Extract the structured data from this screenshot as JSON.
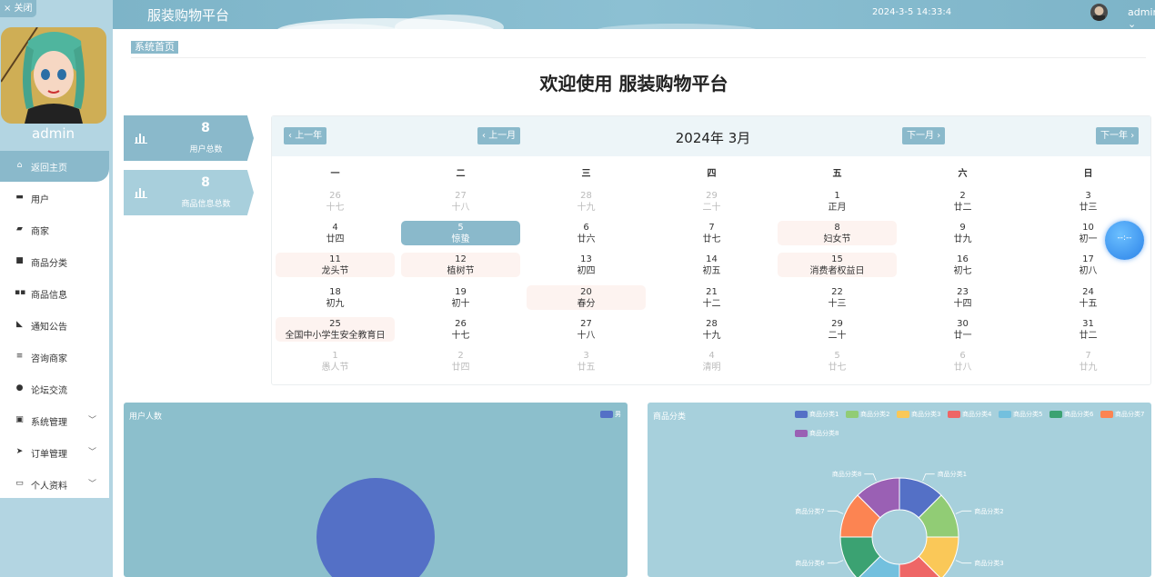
{
  "sidebar": {
    "close_label": "× 关闭",
    "username": "admin",
    "menu": [
      {
        "label": "返回主页",
        "icon": "home-icon",
        "active": true
      },
      {
        "label": "用户",
        "icon": "users-icon"
      },
      {
        "label": "商家",
        "icon": "shop-icon"
      },
      {
        "label": "商品分类",
        "icon": "category-icon"
      },
      {
        "label": "商品信息",
        "icon": "grid-icon"
      },
      {
        "label": "通知公告",
        "icon": "notice-icon"
      },
      {
        "label": "咨询商家",
        "icon": "list-icon"
      },
      {
        "label": "论坛交流",
        "icon": "person-icon"
      },
      {
        "label": "系统管理",
        "icon": "settings-icon",
        "expandable": true
      },
      {
        "label": "订单管理",
        "icon": "send-icon",
        "expandable": true
      },
      {
        "label": "个人资料",
        "icon": "profile-icon",
        "expandable": true
      }
    ]
  },
  "header": {
    "brand": "服装购物平台",
    "datetime": "2024-3-5 14:33:4",
    "user": "admin"
  },
  "breadcrumb": "系统首页",
  "welcome": "欢迎使用 服装购物平台",
  "stats": [
    {
      "value": "8",
      "label": "用户总数"
    },
    {
      "value": "8",
      "label": "商品信息总数"
    }
  ],
  "calendar": {
    "title": "2024年 3月",
    "prev_year": "上一年",
    "prev_month": "上一月",
    "next_month": "下一月",
    "next_year": "下一年",
    "weekdays": [
      "一",
      "二",
      "三",
      "四",
      "五",
      "六",
      "日"
    ],
    "weeks": [
      [
        {
          "d": "26",
          "l": "十七",
          "dim": true
        },
        {
          "d": "27",
          "l": "十八",
          "dim": true
        },
        {
          "d": "28",
          "l": "十九",
          "dim": true
        },
        {
          "d": "29",
          "l": "二十",
          "dim": true
        },
        {
          "d": "1",
          "l": "正月"
        },
        {
          "d": "2",
          "l": "廿二"
        },
        {
          "d": "3",
          "l": "廿三"
        }
      ],
      [
        {
          "d": "4",
          "l": "廿四"
        },
        {
          "d": "5",
          "l": "惊蛰",
          "today": true
        },
        {
          "d": "6",
          "l": "廿六"
        },
        {
          "d": "7",
          "l": "廿七"
        },
        {
          "d": "8",
          "l": "妇女节",
          "hl": true
        },
        {
          "d": "9",
          "l": "廿九"
        },
        {
          "d": "10",
          "l": "初一"
        }
      ],
      [
        {
          "d": "11",
          "l": "龙头节",
          "hl": true
        },
        {
          "d": "12",
          "l": "植树节",
          "hl": true
        },
        {
          "d": "13",
          "l": "初四"
        },
        {
          "d": "14",
          "l": "初五"
        },
        {
          "d": "15",
          "l": "消费者权益日",
          "hl": true
        },
        {
          "d": "16",
          "l": "初七"
        },
        {
          "d": "17",
          "l": "初八"
        }
      ],
      [
        {
          "d": "18",
          "l": "初九"
        },
        {
          "d": "19",
          "l": "初十"
        },
        {
          "d": "20",
          "l": "春分",
          "hl": true
        },
        {
          "d": "21",
          "l": "十二"
        },
        {
          "d": "22",
          "l": "十三"
        },
        {
          "d": "23",
          "l": "十四"
        },
        {
          "d": "24",
          "l": "十五"
        }
      ],
      [
        {
          "d": "25",
          "l": "全国中小学生安全教育日",
          "hl": true
        },
        {
          "d": "26",
          "l": "十七"
        },
        {
          "d": "27",
          "l": "十八"
        },
        {
          "d": "28",
          "l": "十九"
        },
        {
          "d": "29",
          "l": "二十"
        },
        {
          "d": "30",
          "l": "廿一"
        },
        {
          "d": "31",
          "l": "廿二"
        }
      ],
      [
        {
          "d": "1",
          "l": "愚人节",
          "dim": true
        },
        {
          "d": "2",
          "l": "廿四",
          "dim": true
        },
        {
          "d": "3",
          "l": "廿五",
          "dim": true
        },
        {
          "d": "4",
          "l": "清明",
          "dim": true
        },
        {
          "d": "5",
          "l": "廿七",
          "dim": true
        },
        {
          "d": "6",
          "l": "廿八",
          "dim": true
        },
        {
          "d": "7",
          "l": "廿九",
          "dim": true
        }
      ]
    ]
  },
  "float_ball_text": "--:--",
  "chart_data": [
    {
      "type": "pie",
      "title": "用户人数",
      "legend": [
        "男"
      ],
      "labels": [
        "男"
      ],
      "values": [
        8
      ],
      "colors": [
        "#5470c6"
      ]
    },
    {
      "type": "pie",
      "title": "商品分类",
      "legend": [
        "商品分类1",
        "商品分类2",
        "商品分类3",
        "商品分类4",
        "商品分类5",
        "商品分类6",
        "商品分类7",
        "商品分类8"
      ],
      "labels": [
        "商品分类1",
        "商品分类2",
        "商品分类3",
        "商品分类4",
        "商品分类5",
        "商品分类6",
        "商品分类7",
        "商品分类8"
      ],
      "values": [
        1,
        1,
        1,
        1,
        1,
        1,
        1,
        1
      ],
      "colors": [
        "#5470c6",
        "#91cc75",
        "#fac858",
        "#ee6666",
        "#73c0de",
        "#3ba272",
        "#fc8452",
        "#9a60b4"
      ]
    }
  ]
}
